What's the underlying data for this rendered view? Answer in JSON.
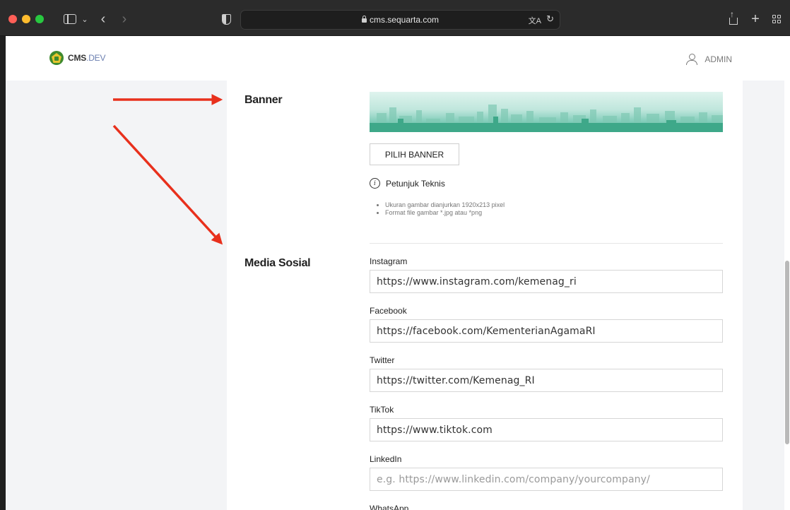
{
  "browser": {
    "url": "cms.sequarta.com"
  },
  "header": {
    "logo_main": "CMS",
    "logo_sub": ".DEV",
    "user_label": "ADMIN"
  },
  "banner_section": {
    "title": "Banner",
    "button_label": "PILIH BANNER",
    "info_title": "Petunjuk Teknis",
    "notes": [
      "Ukuran gambar dianjurkan 1920x213 pixel",
      "Format file gambar *.jpg atau *png"
    ]
  },
  "social_section": {
    "title": "Media Sosial",
    "fields": [
      {
        "label": "Instagram",
        "value": "https://www.instagram.com/kemenag_ri",
        "placeholder": ""
      },
      {
        "label": "Facebook",
        "value": "https://facebook.com/KementerianAgamaRI",
        "placeholder": ""
      },
      {
        "label": "Twitter",
        "value": "https://twitter.com/Kemenag_RI",
        "placeholder": ""
      },
      {
        "label": "TikTok",
        "value": "https://www.tiktok.com",
        "placeholder": ""
      },
      {
        "label": "LinkedIn",
        "value": "",
        "placeholder": "e.g. https://www.linkedin.com/company/yourcompany/"
      },
      {
        "label": "WhatsApp",
        "value": "",
        "placeholder": ""
      }
    ]
  },
  "colors": {
    "arrow": "#e8301c",
    "accent_green": "#3f8a2e"
  }
}
